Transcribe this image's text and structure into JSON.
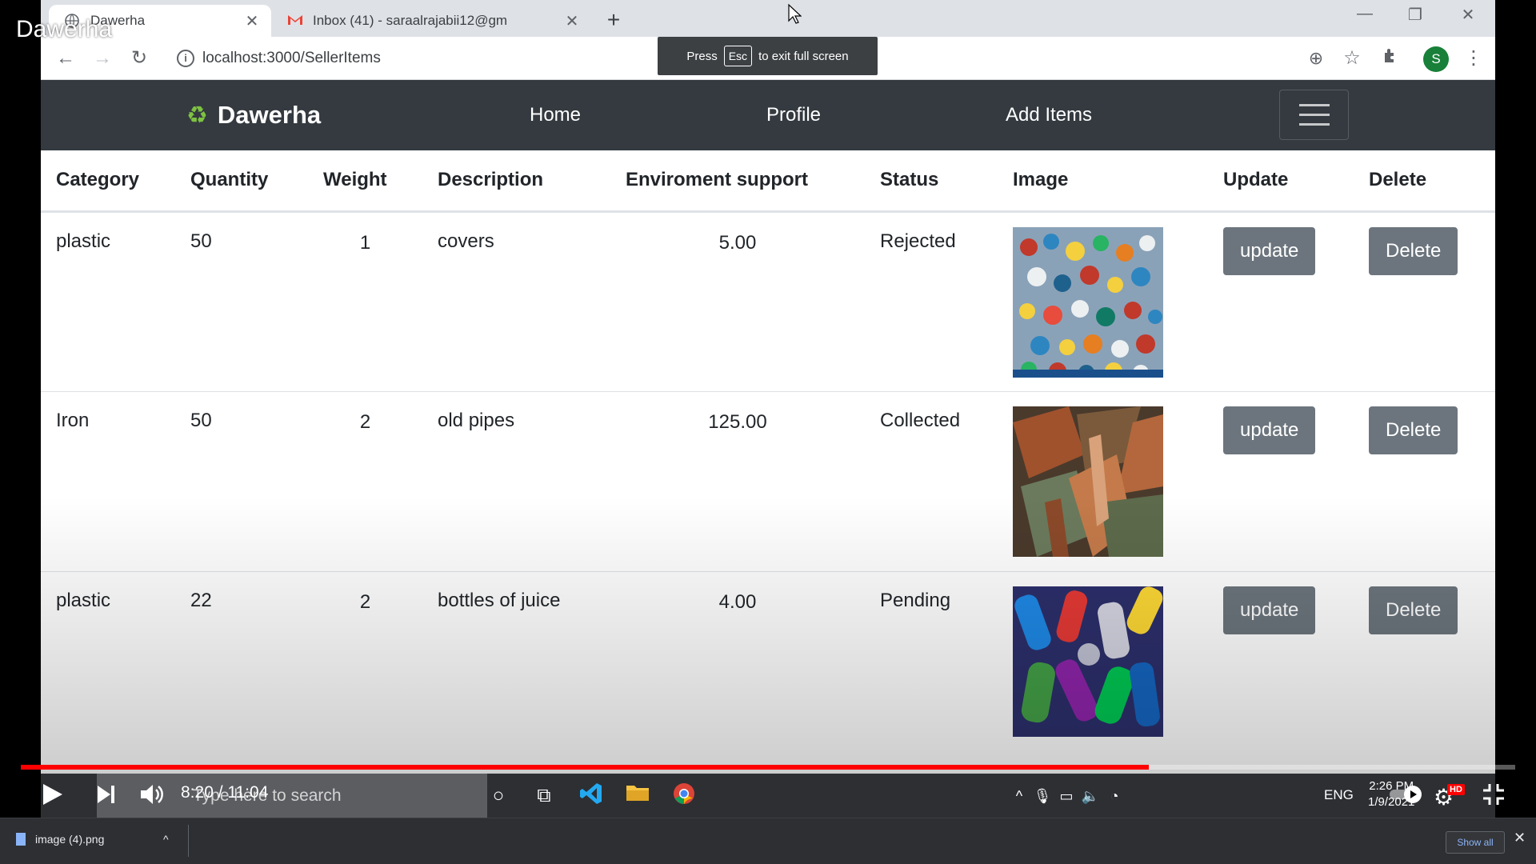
{
  "video": {
    "title": "Dawerha",
    "time": "8:20 / 11:04",
    "progress_fraction": 0.7548
  },
  "browser": {
    "tabs": [
      {
        "title": "Dawerha",
        "active": true
      },
      {
        "title": "Inbox (41) - saraalrajabii12@gm",
        "active": false
      }
    ],
    "new_tab": "+",
    "url": "localhost:3000/SellerItems",
    "profile_initial": "S",
    "fullscreen_toast": {
      "before": "Press",
      "key": "Esc",
      "after": "to exit full screen"
    }
  },
  "app": {
    "brand": "Dawerha",
    "nav": {
      "home": "Home",
      "profile": "Profile",
      "add_items": "Add Items"
    },
    "table": {
      "headers": {
        "category": "Category",
        "quantity": "Quantity",
        "weight": "Weight",
        "description": "Description",
        "env_support": "Enviroment support",
        "status": "Status",
        "image": "Image",
        "update": "Update",
        "delete": "Delete"
      },
      "rows": [
        {
          "category": "plastic",
          "quantity": "50",
          "weight": "1",
          "description": "covers",
          "env_support": "5.00",
          "status": "Rejected",
          "update_label": "update",
          "delete_label": "Delete"
        },
        {
          "category": "Iron",
          "quantity": "50",
          "weight": "2",
          "description": "old pipes",
          "env_support": "125.00",
          "status": "Collected",
          "update_label": "update",
          "delete_label": "Delete"
        },
        {
          "category": "plastic",
          "quantity": "22",
          "weight": "2",
          "description": "bottles of juice",
          "env_support": "4.00",
          "status": "Pending",
          "update_label": "update",
          "delete_label": "Delete"
        }
      ]
    }
  },
  "taskbar": {
    "search_placeholder": "Type here to search",
    "lang": "ENG",
    "time": "2:26 PM",
    "date": "1/9/2021"
  },
  "downloads": {
    "file": "image (4).png",
    "show_all": "Show all"
  }
}
